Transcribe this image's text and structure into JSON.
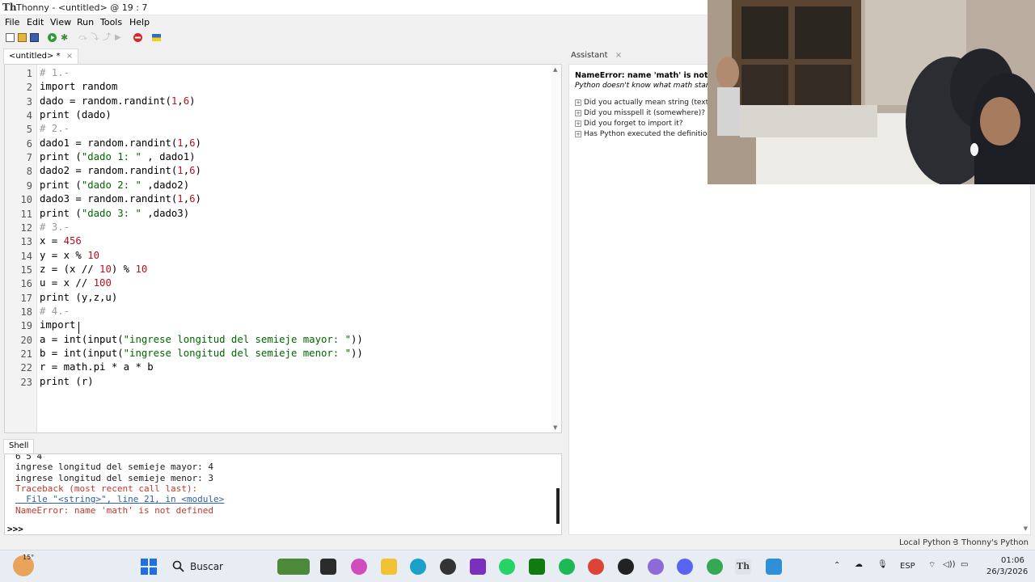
{
  "window": {
    "title": "Thonny  -  <untitled>  @  19 : 7"
  },
  "menu": [
    "File",
    "Edit",
    "View",
    "Run",
    "Tools",
    "Help"
  ],
  "editor": {
    "tab_label": "<untitled> *",
    "lines": [
      "# 1.-",
      "import random",
      "dado = random.randint(1,6)",
      "print (dado)",
      "# 2.-",
      "dado1 = random.randint(1,6)",
      "print (\"dado 1: \" , dado1)",
      "dado2 = random.randint(1,6)",
      "print (\"dado 2: \" ,dado2)",
      "dado3 = random.randint(1,6)",
      "print (\"dado 3: \" ,dado3)",
      "# 3.-",
      "x = 456",
      "y = x % 10",
      "z = (x // 10) % 10",
      "u = x // 100",
      "print (y,z,u)",
      "# 4.-",
      "import",
      "a = int(input(\"ingrese longitud del semieje mayor: \"))",
      "b = int(input(\"ingrese longitud del semieje menor: \"))",
      "r = math.pi * a * b",
      "print (r)"
    ]
  },
  "shell": {
    "tab_label": "Shell",
    "lines": [
      {
        "text": "6 5 4",
        "kind": "out"
      },
      {
        "text": "ingrese longitud del semieje mayor: 4",
        "kind": "out"
      },
      {
        "text": "ingrese longitud del semieje menor: 3",
        "kind": "out"
      },
      {
        "text": "Traceback (most recent call last):",
        "kind": "err"
      },
      {
        "text": "  File \"<string>\", line 21, in <module>",
        "kind": "link"
      },
      {
        "text": "NameError: name 'math' is not defined",
        "kind": "err"
      }
    ],
    "prompt": ">>>"
  },
  "assistant": {
    "tab_label": "Assistant",
    "title": "NameError: name 'math' is not defi",
    "subtitle": "Python doesn't know what math stanc",
    "suggestions": [
      "Did you actually mean string (text)",
      "Did you misspell it (somewhere)?",
      "Did you forget to import it?",
      "Has Python executed the definition"
    ]
  },
  "status": {
    "interpreter": "Local Python 3",
    "mode": "Thonny's Python"
  },
  "taskbar": {
    "weather": "15°",
    "search_placeholder": "Buscar",
    "lang": "ESP",
    "time": "01:06",
    "date": "26/3/2026"
  }
}
